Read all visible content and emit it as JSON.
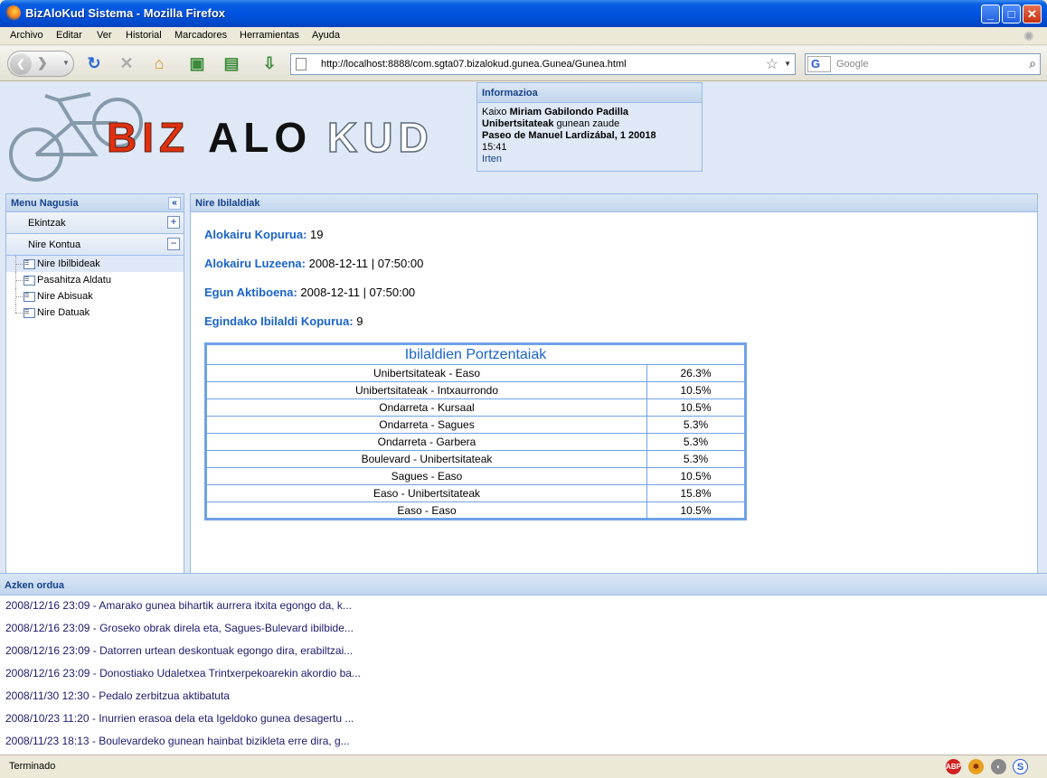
{
  "window": {
    "title": "BizAloKud Sistema - Mozilla Firefox"
  },
  "menubar": {
    "items": [
      "Archivo",
      "Editar",
      "Ver",
      "Historial",
      "Marcadores",
      "Herramientas",
      "Ayuda"
    ]
  },
  "navbar": {
    "url": "http://localhost:8888/com.sgta07.bizalokud.gunea.Gunea/Gunea.html",
    "search_placeholder": "Google"
  },
  "logo": {
    "part1": "BIZ",
    "part2": "ALO",
    "part3": "KUD"
  },
  "info": {
    "title": "Informazioa",
    "greeting": "Kaixo",
    "user": "Miriam Gabilondo Padilla",
    "location_name": "Unibertsitateak",
    "location_suffix": "gunean zaude",
    "address": "Paseo de Manuel Lardizábal, 1 20018",
    "time": "15:41",
    "logout": "Irten"
  },
  "menu": {
    "title": "Menu Nagusia",
    "sections": [
      {
        "label": "Ekintzak",
        "toggle": "+"
      },
      {
        "label": "Nire Kontua",
        "toggle": "−"
      }
    ],
    "items": [
      "Nire Ibilbideak",
      "Pasahitza Aldatu",
      "Nire Abisuak",
      "Nire Datuak"
    ]
  },
  "main": {
    "title": "Nire Ibilaldiak",
    "stats": [
      {
        "label": "Alokairu Kopurua:",
        "value": "19"
      },
      {
        "label": "Alokairu Luzeena:",
        "value": "2008-12-11 | 07:50:00"
      },
      {
        "label": "Egun Aktiboena:",
        "value": "2008-12-11 | 07:50:00"
      },
      {
        "label": "Egindako Ibilaldi Kopurua:",
        "value": "9"
      }
    ],
    "table_title": "Ibilaldien Portzentaiak",
    "rows": [
      {
        "route": "Unibertsitateak - Easo",
        "pct": "26.3%"
      },
      {
        "route": "Unibertsitateak - Intxaurrondo",
        "pct": "10.5%"
      },
      {
        "route": "Ondarreta - Kursaal",
        "pct": "10.5%"
      },
      {
        "route": "Ondarreta - Sagues",
        "pct": "5.3%"
      },
      {
        "route": "Ondarreta - Garbera",
        "pct": "5.3%"
      },
      {
        "route": "Boulevard - Unibertsitateak",
        "pct": "5.3%"
      },
      {
        "route": "Sagues - Easo",
        "pct": "10.5%"
      },
      {
        "route": "Easo - Unibertsitateak",
        "pct": "15.8%"
      },
      {
        "route": "Easo - Easo",
        "pct": "10.5%"
      }
    ]
  },
  "news": {
    "title": "Azken ordua",
    "items": [
      "2008/12/16 23:09 - Amarako gunea bihartik aurrera itxita egongo da, k...",
      "2008/12/16 23:09 - Groseko obrak direla eta, Sagues-Bulevard ibilbide...",
      "2008/12/16 23:09 - Datorren urtean deskontuak egongo dira, erabiltzai...",
      "2008/12/16 23:09 - Donostiako Udaletxea Trintxerpekoarekin akordio ba...",
      "2008/11/30 12:30 - Pedalo zerbitzua aktibatuta",
      "2008/10/23 11:20 - Inurrien erasoa dela eta Igeldoko gunea desagertu ...",
      "2008/11/23 18:13 - Boulevardeko gunean hainbat bizikleta erre dira, g..."
    ]
  },
  "status": {
    "text": "Terminado",
    "abp": "ABP"
  }
}
